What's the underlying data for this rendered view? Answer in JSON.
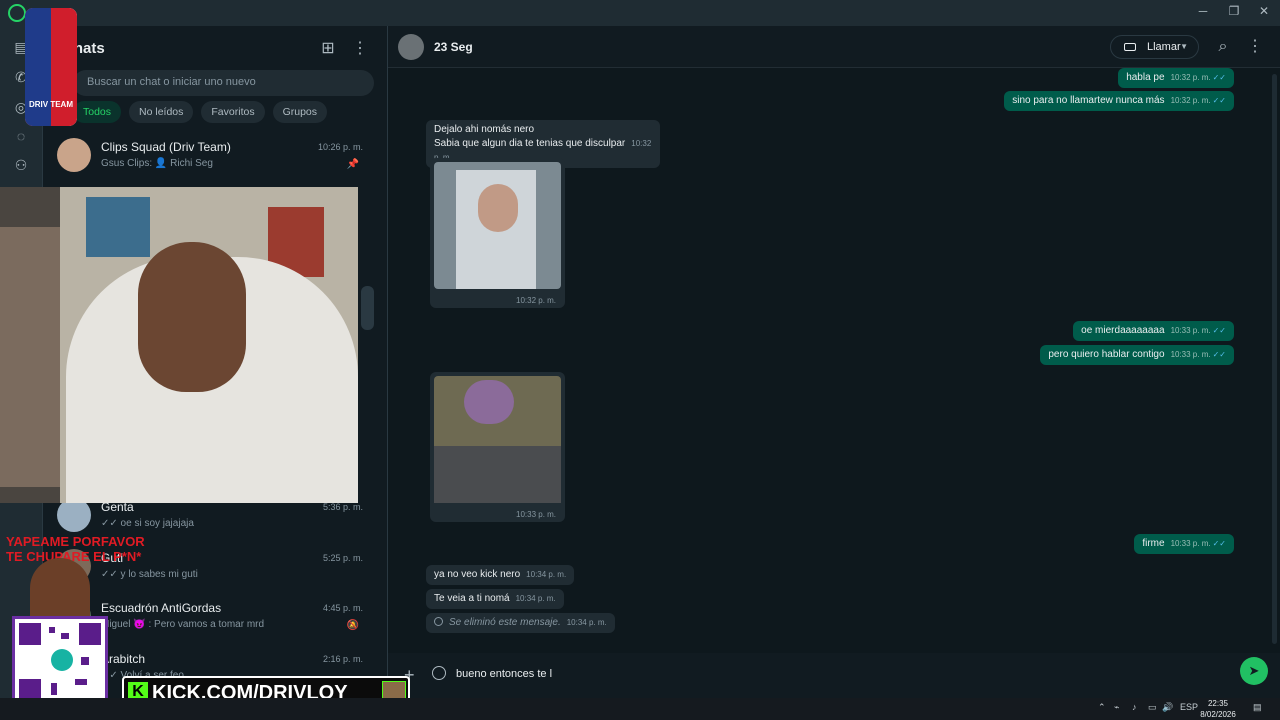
{
  "window": {
    "minimize": "─",
    "maximize": "❐",
    "close": "✕"
  },
  "sidebar": {
    "title": "Chats",
    "search_placeholder": "Buscar un chat o iniciar uno nuevo",
    "filters": [
      "Todos",
      "No leídos",
      "Favoritos",
      "Grupos"
    ],
    "chats": [
      {
        "name": "Clips Squad (Driv Team)",
        "time": "10:26 p. m.",
        "preview": "Gsus Clips: 👤 Richi Seg",
        "pinned": true
      },
      {
        "name": "Genta",
        "time": "5:36 p. m.",
        "preview": "✓✓ oe si soy jajajaja"
      },
      {
        "name": "Guti",
        "time": "5:25 p. m.",
        "preview": "✓✓ y lo sabes mi guti"
      },
      {
        "name": "Escuadrón AntiGordas",
        "time": "4:45 p. m.",
        "preview": "Miguel 😈 : Pero vamos a tomar mrd",
        "muted": true
      },
      {
        "name": "Arabitch",
        "time": "2:16 p. m.",
        "preview": "✓✓ Volví a ser feo"
      }
    ]
  },
  "conversation": {
    "name": "23 Seg",
    "call_label": "Llamar",
    "messages": [
      {
        "dir": "out",
        "text": "habla pe",
        "time": "10:32 p. m."
      },
      {
        "dir": "out",
        "text": "sino para no llamartew nunca más",
        "time": "10:32 p. m."
      },
      {
        "dir": "in",
        "text": "Dejalo ahi nomás nero",
        "time": ""
      },
      {
        "dir": "in",
        "text": "Sabia que algun dia te tenias que disculpar",
        "time": "10:32 p. m."
      },
      {
        "dir": "in",
        "type": "image",
        "time": "10:32 p. m."
      },
      {
        "dir": "out",
        "text": "oe mierdaaaaaaaa",
        "time": "10:33 p. m."
      },
      {
        "dir": "out",
        "text": "pero quiero hablar contigo",
        "time": "10:33 p. m."
      },
      {
        "dir": "in",
        "type": "image",
        "time": "10:33 p. m."
      },
      {
        "dir": "out",
        "text": "firme",
        "time": "10:33 p. m."
      },
      {
        "dir": "in",
        "text": "ya no veo kick nero",
        "time": "10:34 p. m."
      },
      {
        "dir": "in",
        "text": "Te veia a ti nomá",
        "time": "10:34 p. m."
      },
      {
        "dir": "in",
        "text": "Se eliminó este mensaje.",
        "time": "10:34 p. m.",
        "deleted": true
      }
    ],
    "composer_value": "bueno entonces te l"
  },
  "overlay": {
    "logo_text": "DRIV TEAM",
    "promo_line1": "YAPEAME PORFAVOR",
    "promo_line2": "TE CHUPARE EL P*N*",
    "kick_url": "KICK.COM/DRIVLOY"
  },
  "taskbar": {
    "lang": "ESP",
    "time": "22:35",
    "date": "8/02/2026"
  }
}
